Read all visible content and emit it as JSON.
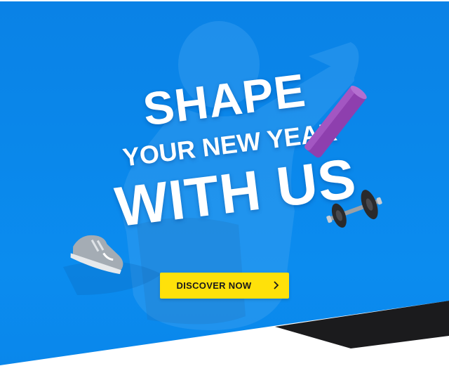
{
  "headline": {
    "line1": "SHAPE",
    "line2": "YOUR NEW YEAR",
    "line3": "WITH US"
  },
  "cta": {
    "label": "DISCOVER NOW",
    "icon": "chevron-right-icon"
  },
  "colors": {
    "hero_blue": "#0a87ea",
    "cta_yellow": "#ffe10a",
    "wedge_black": "#1b1b1d",
    "text_white": "#ffffff"
  },
  "products": {
    "shoe_icon": "running-shoe-icon",
    "mat_icon": "yoga-mat-icon",
    "dumbbell_icon": "dumbbell-icon"
  }
}
